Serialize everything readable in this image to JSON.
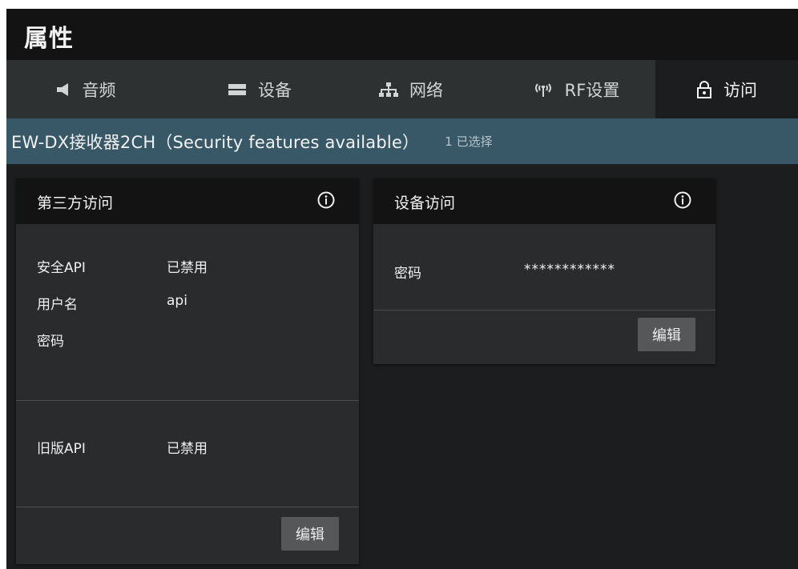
{
  "window": {
    "title": "属性"
  },
  "tabs": [
    {
      "label": "音频",
      "icon": "speaker-icon",
      "active": false
    },
    {
      "label": "设备",
      "icon": "device-icon",
      "active": false
    },
    {
      "label": "网络",
      "icon": "network-icon",
      "active": false
    },
    {
      "label": "RF设置",
      "icon": "antenna-icon",
      "active": false
    },
    {
      "label": "访问",
      "icon": "lock-icon",
      "active": true
    }
  ],
  "device": {
    "name": "EW-DX接收器2CH（Security features available）",
    "selected": "1 已选择"
  },
  "third_party_panel": {
    "title": "第三方访问",
    "info_icon": "info-icon",
    "rows": [
      {
        "label": "安全API",
        "value": "已禁用"
      },
      {
        "label": "用户名",
        "value": "api"
      },
      {
        "label": "密码",
        "value": ""
      }
    ],
    "legacy": {
      "label": "旧版API",
      "value": "已禁用"
    },
    "edit_label": "编辑"
  },
  "device_access_panel": {
    "title": "设备访问",
    "info_icon": "info-icon",
    "password_label": "密码",
    "password_value": "************",
    "edit_label": "编辑"
  },
  "colors": {
    "titlebar_bg": "#131313",
    "tabbar_bg": "#2e3132",
    "subbar_bg": "#385867",
    "content_bg": "#1b1d1e",
    "panel_bg": "#2a2b2c",
    "button_bg": "#555758"
  }
}
